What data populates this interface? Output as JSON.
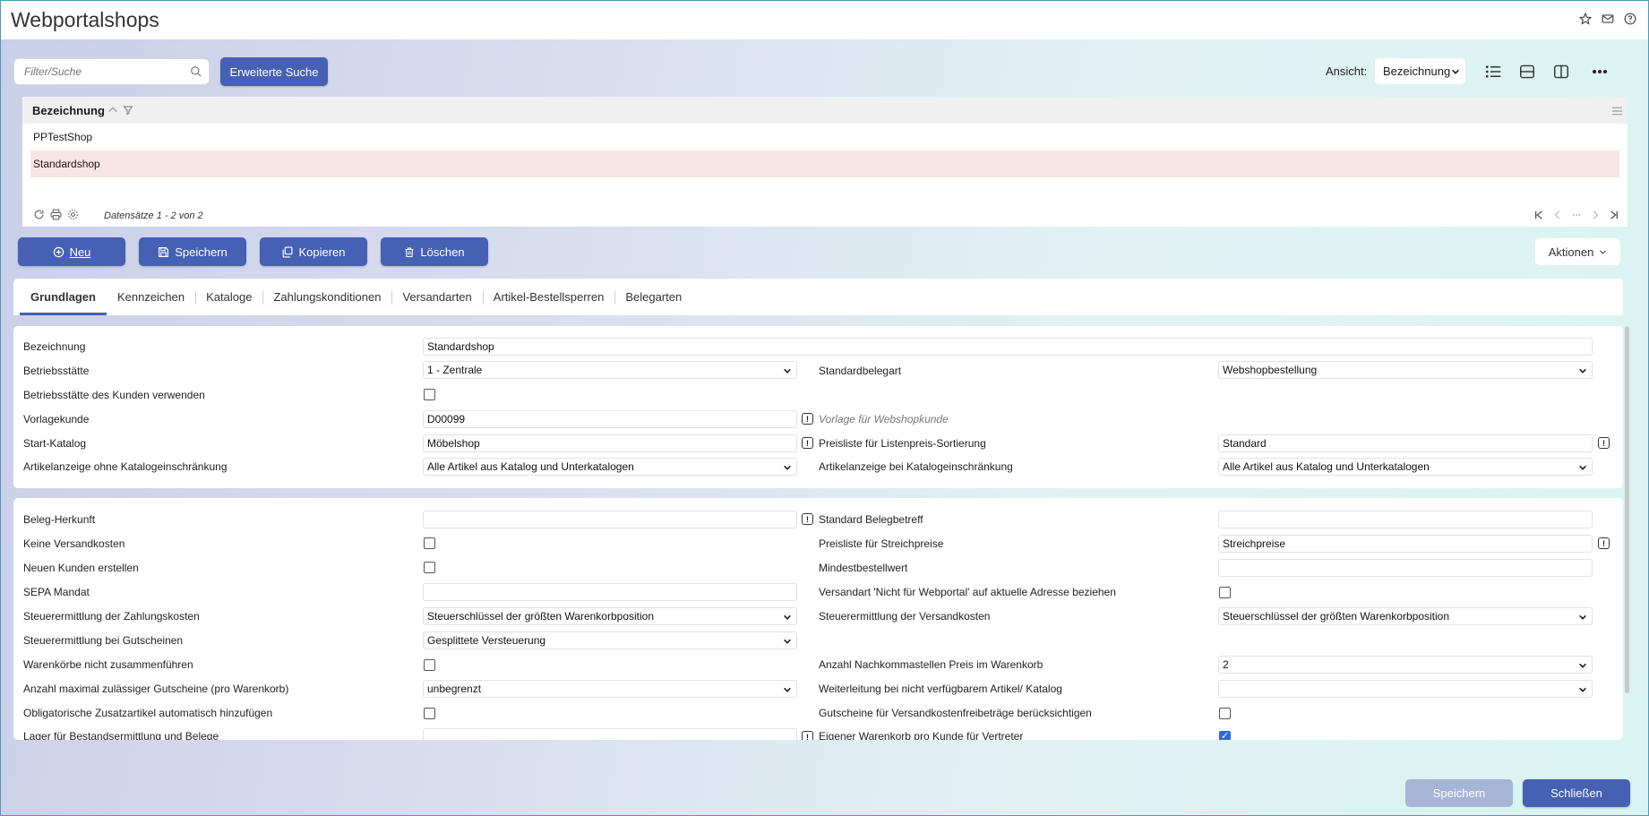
{
  "window": {
    "title": "Webportalshops"
  },
  "title_icons": [
    "star-icon",
    "mail-icon",
    "help-icon"
  ],
  "search": {
    "placeholder": "Filter/Suche",
    "advanced_label": "Erweiterte Suche"
  },
  "view": {
    "label": "Ansicht:",
    "selected": "Bezeichnung"
  },
  "grid": {
    "column": "Bezeichnung",
    "rows": [
      "PPTestShop",
      "Standardshop"
    ],
    "selected_row": 1,
    "records": "Datensätze 1 - 2 von 2"
  },
  "actions": {
    "new": "Neu",
    "save": "Speichern",
    "copy": "Kopieren",
    "delete": "Löschen",
    "more": "Aktionen"
  },
  "tabs": [
    "Grundlagen",
    "Kennzeichen",
    "Kataloge",
    "Zahlungskonditionen",
    "Versandarten",
    "Artikel-Bestellsperren",
    "Belegarten"
  ],
  "section1": {
    "bezeichnung": {
      "label": "Bezeichnung",
      "value": "Standardshop"
    },
    "betriebsstaette": {
      "label": "Betriebsstätte",
      "value": "1 - Zentrale"
    },
    "standardbelegart": {
      "label": "Standardbelegart",
      "value": "Webshopbestellung"
    },
    "betriebsstaette_kunde": {
      "label": "Betriebsstätte des Kunden verwenden",
      "checked": false
    },
    "vorlagekunde": {
      "label": "Vorlagekunde",
      "value": "D00099",
      "hint": "Vorlage für Webshopkunde"
    },
    "start_katalog": {
      "label": "Start-Katalog",
      "value": "Möbelshop"
    },
    "preisliste_listenpreis": {
      "label": "Preisliste für Listenpreis-Sortierung",
      "value": "Standard"
    },
    "artikelanzeige_ohne": {
      "label": "Artikelanzeige ohne Katalogeinschränkung",
      "value": "Alle Artikel aus Katalog und Unterkatalogen"
    },
    "artikelanzeige_bei": {
      "label": "Artikelanzeige bei Katalogeinschränkung",
      "value": "Alle Artikel aus Katalog und Unterkatalogen"
    }
  },
  "section2": {
    "beleg_herkunft": {
      "label": "Beleg-Herkunft",
      "value": ""
    },
    "standard_belegbetreff": {
      "label": "Standard Belegbetreff",
      "value": ""
    },
    "keine_versandkosten": {
      "label": "Keine Versandkosten",
      "checked": false
    },
    "preisliste_streichpreise": {
      "label": "Preisliste für Streichpreise",
      "value": "Streichpreise"
    },
    "neuen_kunden": {
      "label": "Neuen Kunden erstellen",
      "checked": false
    },
    "mindestbestellwert": {
      "label": "Mindestbestellwert",
      "value": ""
    },
    "sepa_mandat": {
      "label": "SEPA Mandat",
      "value": ""
    },
    "versandart_nicht": {
      "label": "Versandart 'Nicht für Webportal' auf aktuelle Adresse beziehen",
      "checked": false
    },
    "steuer_zahlungskosten": {
      "label": "Steuerermittlung der Zahlungskosten",
      "value": "Steuerschlüssel der größten Warenkorbposition"
    },
    "steuer_versandkosten": {
      "label": "Steuerermittlung der Versandkosten",
      "value": "Steuerschlüssel der größten Warenkorbposition"
    },
    "steuer_gutscheine": {
      "label": "Steuerermittlung bei Gutscheinen",
      "value": "Gesplittete Versteuerung"
    },
    "warenkoerbe_nicht": {
      "label": "Warenkörbe nicht zusammenführen",
      "checked": false
    },
    "nachkommastellen": {
      "label": "Anzahl Nachkommastellen Preis im Warenkorb",
      "value": "2"
    },
    "max_gutscheine": {
      "label": "Anzahl maximal zulässiger Gutscheine (pro Warenkorb)",
      "value": "unbegrenzt"
    },
    "weiterleitung": {
      "label": "Weiterleitung bei nicht verfügbarem Artikel/ Katalog",
      "value": ""
    },
    "obligatorische": {
      "label": "Obligatorische Zusatzartikel automatisch hinzufügen",
      "checked": false
    },
    "gutscheine_versand": {
      "label": "Gutscheine für Versandkostenfreibeträge berücksichtigen",
      "checked": false
    },
    "lager": {
      "label": "Lager für Bestandsermittlung und Belege",
      "value": ""
    },
    "eigener_warenkorb": {
      "label": "Eigener Warenkorb pro Kunde für Vertreter",
      "checked": true
    }
  },
  "footer": {
    "save": "Speichern",
    "close": "Schließen"
  }
}
